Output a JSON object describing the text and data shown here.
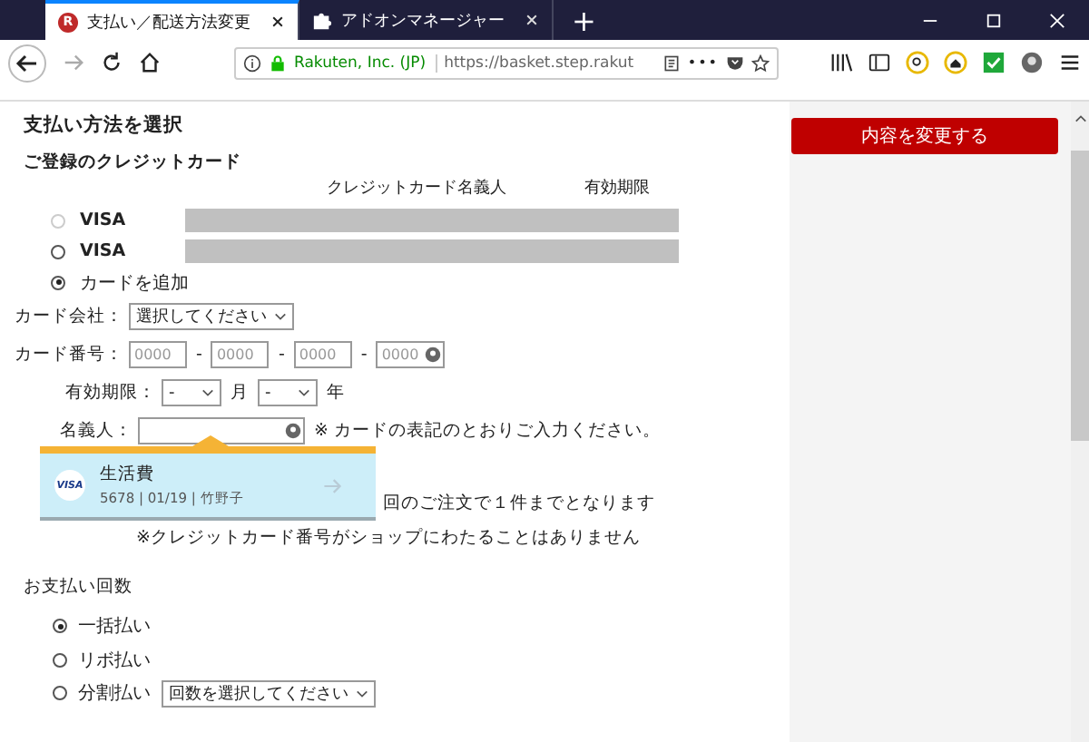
{
  "browser": {
    "tabs": [
      {
        "title": "支払い／配送方法変更",
        "selected": true,
        "kind": "site",
        "logo_letter": "R"
      },
      {
        "title": "アドオンマネージャー",
        "selected": false,
        "kind": "extension"
      }
    ],
    "new_tab": "+",
    "identity": "Rakuten, Inc. (JP)",
    "url": "https://basket.step.rakut",
    "menu_dots": "•••"
  },
  "page": {
    "heading": "支払い方法を選択",
    "registered_cards": {
      "title": "ご登録のクレジットカード",
      "columns": [
        "クレジットカード名義人",
        "有効期限"
      ],
      "cards": [
        {
          "brand": "VISA",
          "selected": false,
          "disabled": true
        },
        {
          "brand": "VISA",
          "selected": false,
          "disabled": false
        }
      ],
      "add_card": {
        "label": "カードを追加",
        "selected": true
      }
    },
    "form": {
      "company": {
        "label": "カード会社：",
        "value": "選択してください"
      },
      "number": {
        "label": "カード番号：",
        "placeholders": [
          "0000",
          "0000",
          "0000",
          "0000"
        ],
        "separator": "-"
      },
      "expiry": {
        "label": "有効期限：",
        "month_value": "-",
        "month_unit": "月",
        "year_value": "-",
        "year_unit": "年"
      },
      "holder": {
        "label": "名義人：",
        "note": "※ カードの表記のとおりご入力ください。"
      }
    },
    "autocomplete": {
      "brand": "VISA",
      "title": "生活費",
      "detail": "5678 | 01/19 | 竹野子"
    },
    "notes": [
      "回のご注文で１件までとなります",
      "※クレジットカード番号がショップにわたることはありません"
    ],
    "installments": {
      "title": "お支払い回数",
      "options": [
        {
          "label": "一括払い",
          "selected": true,
          "kind": "plain"
        },
        {
          "label": "リボ払い",
          "selected": false,
          "kind": "plain"
        },
        {
          "label": "分割払い",
          "selected": false,
          "kind": "select",
          "select_value": "回数を選択してください"
        }
      ]
    }
  },
  "sidebar": {
    "button": "内容を変更する"
  }
}
